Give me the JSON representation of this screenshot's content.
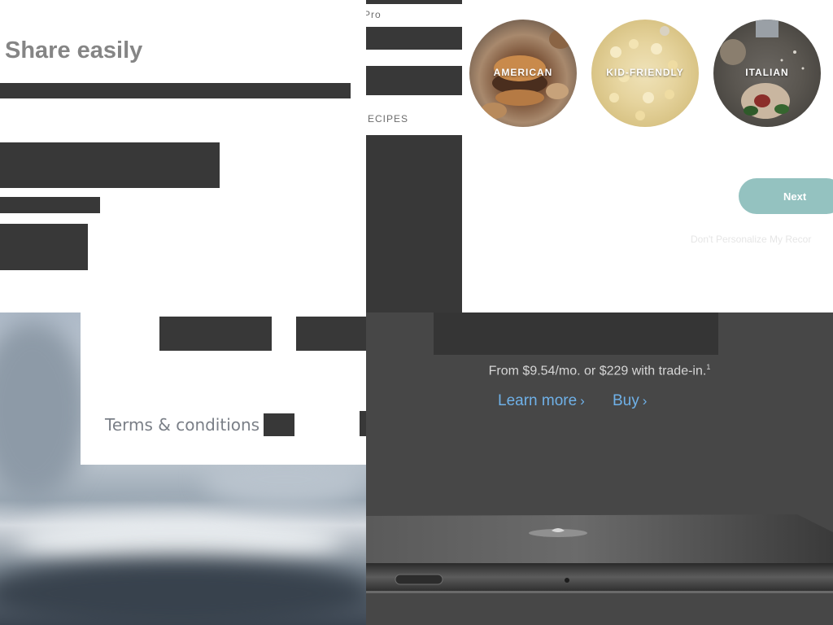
{
  "share_panel": {
    "title": "Share easily"
  },
  "terms_panel": {
    "terms_label": "Terms & conditions",
    "separator": "·"
  },
  "recipes_panel": {
    "pro_label": "Pro",
    "recipes_label": "ECIPES",
    "categories": [
      {
        "label": "AMERICAN"
      },
      {
        "label": "KID-FRIENDLY"
      },
      {
        "label": "ITALIAN"
      }
    ],
    "next_label": "Next",
    "dont_personalize_label": "Don't Personalize My Recor",
    "accent_color": "#94c2c0"
  },
  "phone_panel": {
    "price_text": "From $9.54/mo. or $229 with trade-in.",
    "price_footnote": "1",
    "learn_more_label": "Learn more",
    "buy_label": "Buy",
    "chevron": "›",
    "link_color": "#6fb1e8"
  }
}
